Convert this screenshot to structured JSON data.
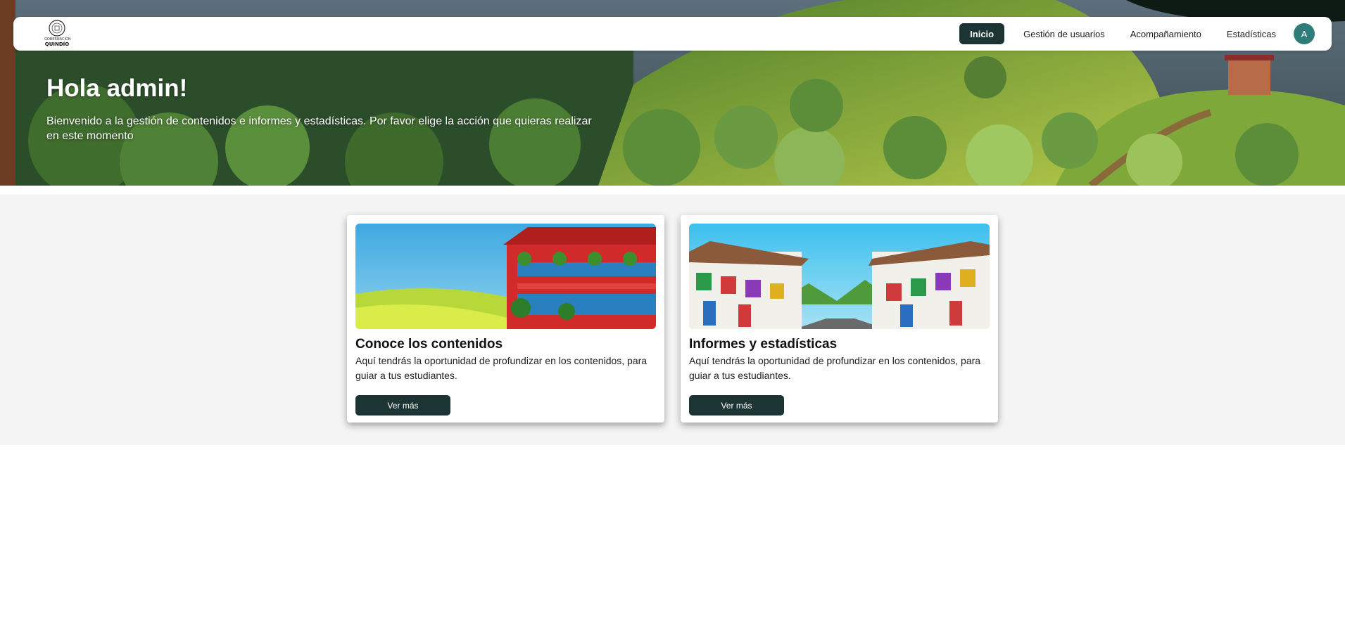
{
  "nav": {
    "logo_line1": "GOBERNACIÓN",
    "logo_line2": "QUINDÍO",
    "items": [
      {
        "label": "Inicio",
        "active": true
      },
      {
        "label": "Gestión de usuarios",
        "active": false
      },
      {
        "label": "Acompañamiento",
        "active": false
      },
      {
        "label": "Estadísticas",
        "active": false
      }
    ],
    "avatar_initial": "A"
  },
  "hero": {
    "title": "Hola admin!",
    "subtitle": "Bienvenido a la gestión de contenidos e informes y estadísticas. Por favor elige la acción que quieras realizar en este momento"
  },
  "cards": [
    {
      "title": "Conoce los contenidos",
      "description": "Aquí tendrás la oportunidad de profundizar en los contenidos, para guiar a tus estudiantes.",
      "button_label": "Ver más"
    },
    {
      "title": "Informes y estadísticas",
      "description": "Aquí tendrás la oportunidad de profundizar en los contenidos, para guiar a tus estudiantes.",
      "button_label": "Ver más"
    }
  ],
  "colors": {
    "primary_dark": "#1c3534",
    "avatar_bg": "#2e7d7a",
    "content_bg": "#f4f4f4"
  },
  "icons": {
    "logo": "gobernacion-quindio-seal-icon"
  }
}
